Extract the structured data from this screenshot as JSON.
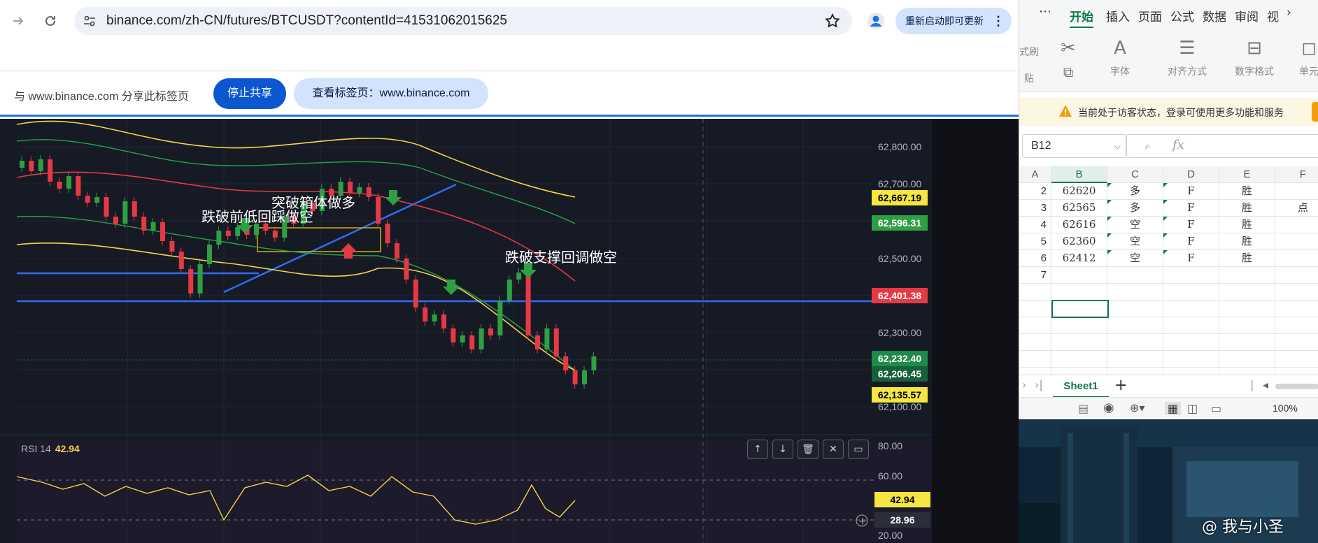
{
  "browser": {
    "url": "binance.com/zh-CN/futures/BTCUSDT?contentId=41531062015625",
    "update_button": "重新启动即可更新",
    "share_text": "与 www.binance.com 分享此标签页",
    "stop_share": "停止共享",
    "view_tab": "查看标签页：www.binance.com"
  },
  "chart": {
    "y_axis_labels": [
      "62,800.00",
      "62,700.00",
      "62,500.00",
      "62,300.00",
      "62,100.00"
    ],
    "price_tags": [
      {
        "label": "62,667.19",
        "bg": "#f5e642",
        "fg": "#000000"
      },
      {
        "label": "62,596.31",
        "bg": "#2ea043",
        "fg": "#ffffff"
      },
      {
        "label": "62,401.38",
        "bg": "#e53945",
        "fg": "#ffffff"
      },
      {
        "label": "62,232.40",
        "bg": "#1e8a4c",
        "fg": "#ffffff"
      },
      {
        "label": "62,206.45",
        "bg": "#17603a",
        "fg": "#ffffff"
      },
      {
        "label": "62,135.57",
        "bg": "#f5e642",
        "fg": "#000000"
      }
    ],
    "annotations": [
      "跌破前低回踩做空",
      "突破箱体做多",
      "跌破支撑回调做空"
    ],
    "rsi": {
      "label": "RSI 14",
      "value": "42.94",
      "axis_labels": [
        "80.00",
        "60.00",
        "20.00"
      ],
      "tag_current": "42.94",
      "tag_low": "28.96"
    }
  },
  "spreadsheet": {
    "tabs": [
      "开始",
      "插入",
      "页面",
      "公式",
      "数据",
      "审阅",
      "视"
    ],
    "tool_labels": [
      "字体",
      "对齐方式",
      "数字格式",
      "单元"
    ],
    "ribbon_side_labels": [
      "式刷",
      "贴"
    ],
    "guest_notice": "当前处于访客状态，登录可使用更多功能和服务",
    "name_box": "B12",
    "fx": "fx",
    "columns": [
      "A",
      "B",
      "C",
      "D",
      "E",
      "F"
    ],
    "rows": [
      {
        "n": "2",
        "b": "62620",
        "c": "多",
        "d": "F",
        "e": "胜",
        "f": ""
      },
      {
        "n": "3",
        "b": "62565",
        "c": "多",
        "d": "F",
        "e": "胜",
        "f": "点"
      },
      {
        "n": "4",
        "b": "62616",
        "c": "空",
        "d": "F",
        "e": "胜",
        "f": ""
      },
      {
        "n": "5",
        "b": "62360",
        "c": "空",
        "d": "F",
        "e": "胜",
        "f": ""
      },
      {
        "n": "6",
        "b": "62412",
        "c": "空",
        "d": "F",
        "e": "胜",
        "f": ""
      },
      {
        "n": "7",
        "b": "",
        "c": "",
        "d": "",
        "e": "",
        "f": ""
      }
    ],
    "sheet_tab": "Sheet1",
    "zoom": "100%"
  },
  "video": {
    "watermark": "@ 我与小圣"
  }
}
